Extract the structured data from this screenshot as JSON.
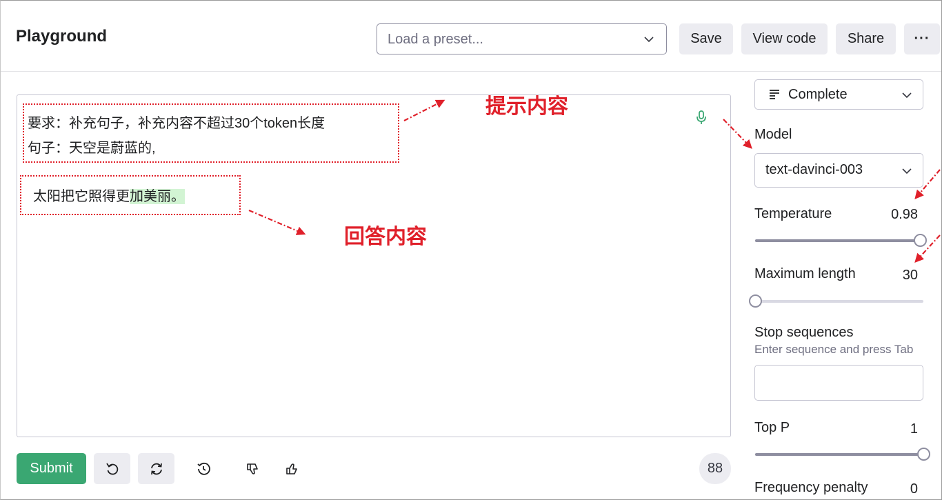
{
  "header": {
    "title": "Playground",
    "preset_placeholder": "Load a preset...",
    "save_label": "Save",
    "view_code_label": "View code",
    "share_label": "Share",
    "more_label": "···"
  },
  "editor": {
    "prompt_line1": "要求：补充句子，补充内容不超过30个token长度",
    "prompt_line2": "句子：天空是蔚蓝的,",
    "answer_plain": "太阳把它照得更",
    "answer_highlight": "加美丽。"
  },
  "annotations": {
    "prompt_label": "提示内容",
    "answer_label": "回答内容",
    "color": "#e0202a"
  },
  "toolbar": {
    "submit_label": "Submit",
    "token_count": "88",
    "submit_color": "#3aa772"
  },
  "settings": {
    "mode": "Complete",
    "model_label": "Model",
    "model_value": "text-davinci-003",
    "temperature_label": "Temperature",
    "temperature_value": "0.98",
    "temperature_fraction": 0.98,
    "max_length_label": "Maximum length",
    "max_length_value": "30",
    "max_length_fraction": 0.0,
    "stop_label": "Stop sequences",
    "stop_hint": "Enter sequence and press Tab",
    "top_p_label": "Top P",
    "top_p_value": "1",
    "top_p_fraction": 1.0,
    "frequency_label": "Frequency penalty",
    "frequency_value": "0"
  },
  "icons": [
    "chevron-down-icon",
    "microphone-icon",
    "undo-icon",
    "regenerate-icon",
    "history-icon",
    "thumbs-down-icon",
    "thumbs-up-icon",
    "mode-lines-icon"
  ]
}
